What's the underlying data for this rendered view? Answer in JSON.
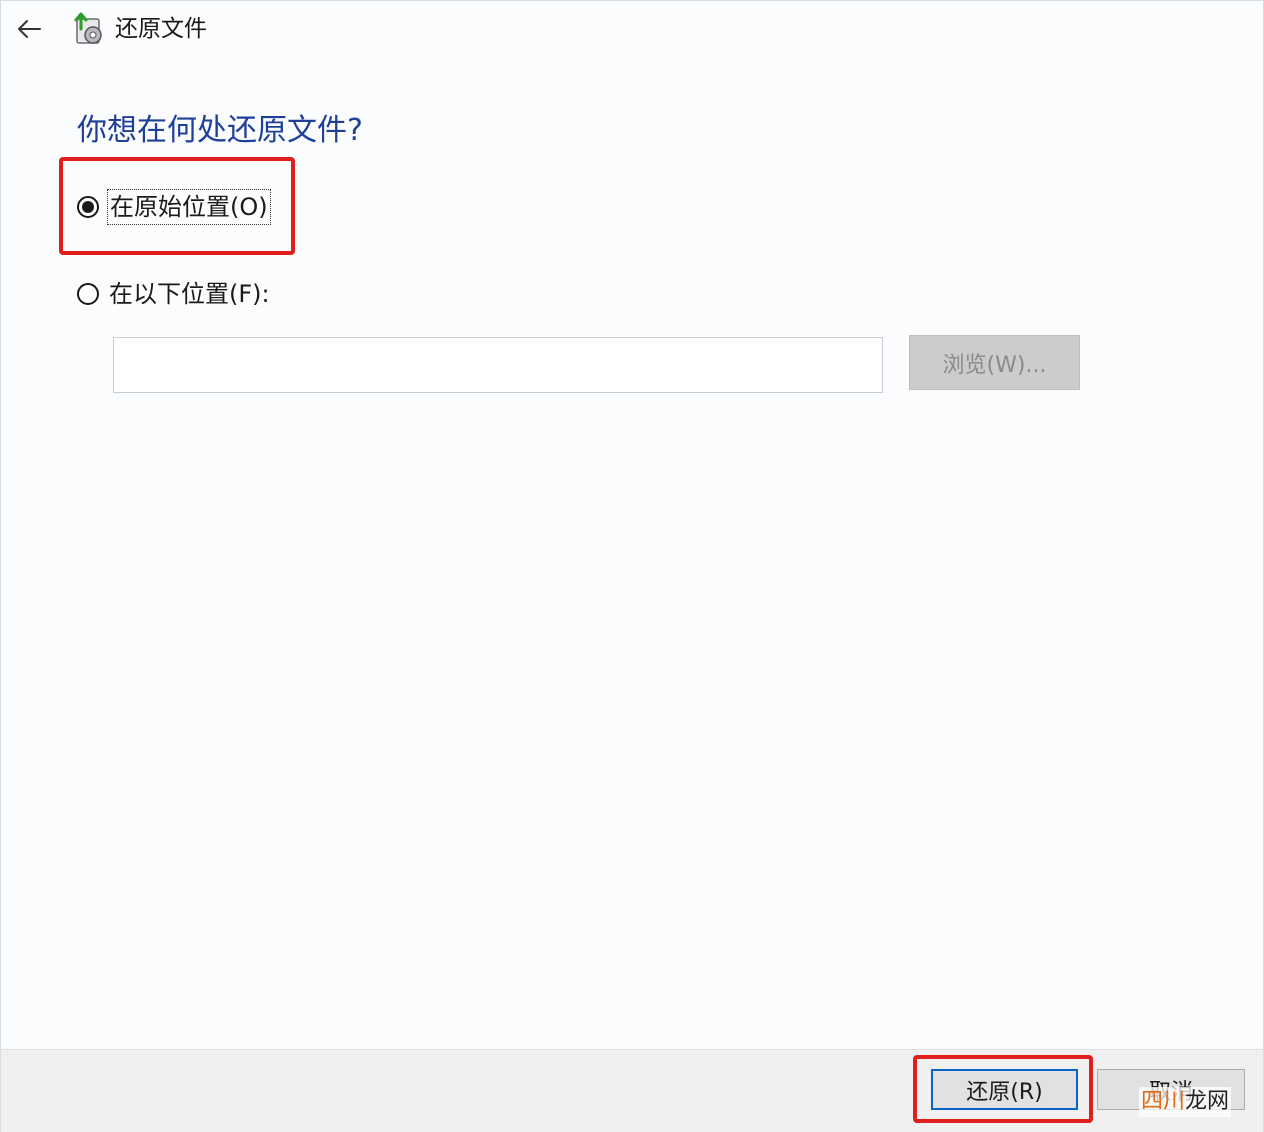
{
  "window": {
    "title": "还原文件",
    "back_icon": "arrow-left-icon",
    "app_icon": "file-restore-icon"
  },
  "main": {
    "question": "你想在何处还原文件?",
    "options": [
      {
        "label": "在原始位置(O)",
        "selected": true
      },
      {
        "label": "在以下位置(F):",
        "selected": false
      }
    ],
    "path_input": {
      "value": "",
      "placeholder": ""
    },
    "browse_label": "浏览(W)..."
  },
  "footer": {
    "restore_label": "还原(R)",
    "cancel_label": "取消"
  },
  "watermark": {
    "brand": "四川",
    "rest": "龙网"
  },
  "colors": {
    "question": "#1f3f99",
    "highlight": "#e01e1e",
    "default_button_border": "#0a64c8"
  }
}
